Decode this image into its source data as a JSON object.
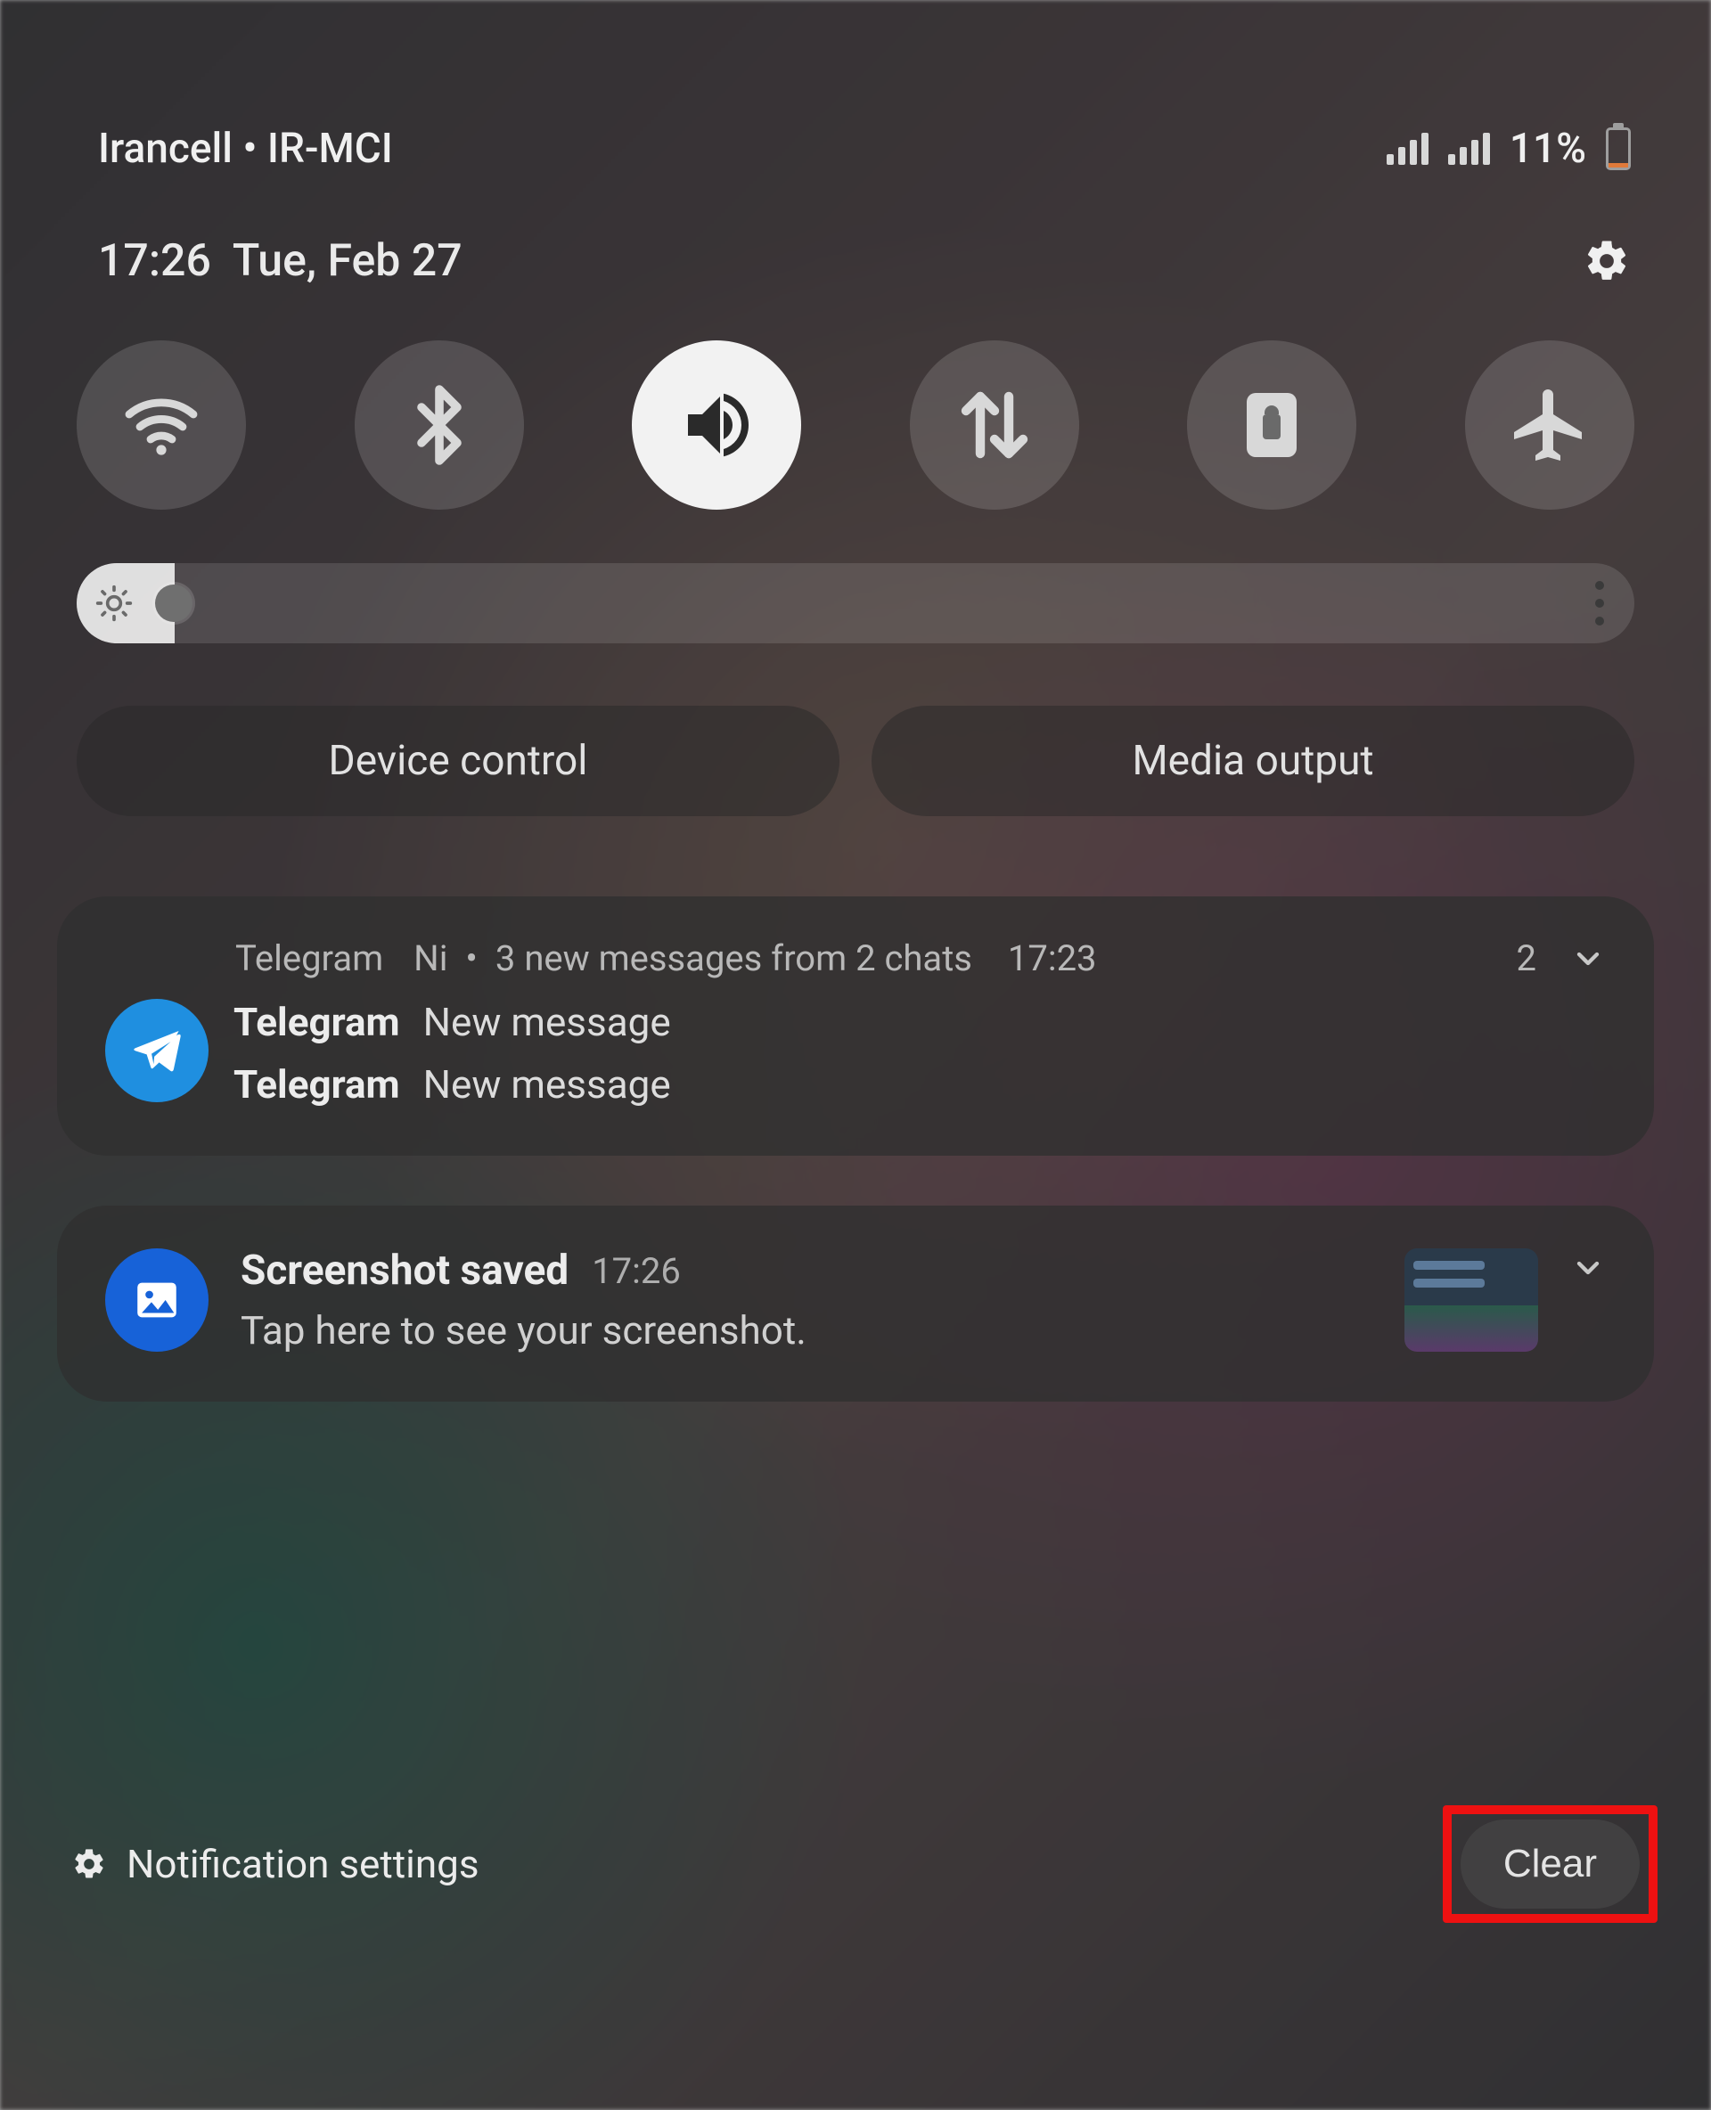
{
  "status": {
    "carrier": "Irancell • IR-MCI",
    "battery_text": "11%",
    "battery_percent": 11
  },
  "header": {
    "time": "17:26",
    "date": "Tue, Feb 27"
  },
  "quick_settings": {
    "tiles": [
      {
        "name": "wifi",
        "active": false
      },
      {
        "name": "bluetooth",
        "active": false
      },
      {
        "name": "sound",
        "active": true
      },
      {
        "name": "mobile-data",
        "active": false
      },
      {
        "name": "rotation-lock",
        "active": false
      },
      {
        "name": "airplane-mode",
        "active": false
      }
    ]
  },
  "brightness": {
    "percent": 6
  },
  "panel_buttons": {
    "device_control": "Device control",
    "media_output": "Media output"
  },
  "notifications": [
    {
      "app": "Telegram",
      "sub": "Ni",
      "summary": "3 new messages from 2 chats",
      "time": "17:23",
      "count": "2",
      "messages": [
        {
          "sender": "Telegram",
          "text": "New message"
        },
        {
          "sender": "Telegram",
          "text": "New message"
        }
      ]
    },
    {
      "app": "Screenshot",
      "title": "Screenshot saved",
      "time": "17:26",
      "subtitle": "Tap here to see your screenshot."
    }
  ],
  "footer": {
    "settings_label": "Notification settings",
    "clear_label": "Clear"
  }
}
